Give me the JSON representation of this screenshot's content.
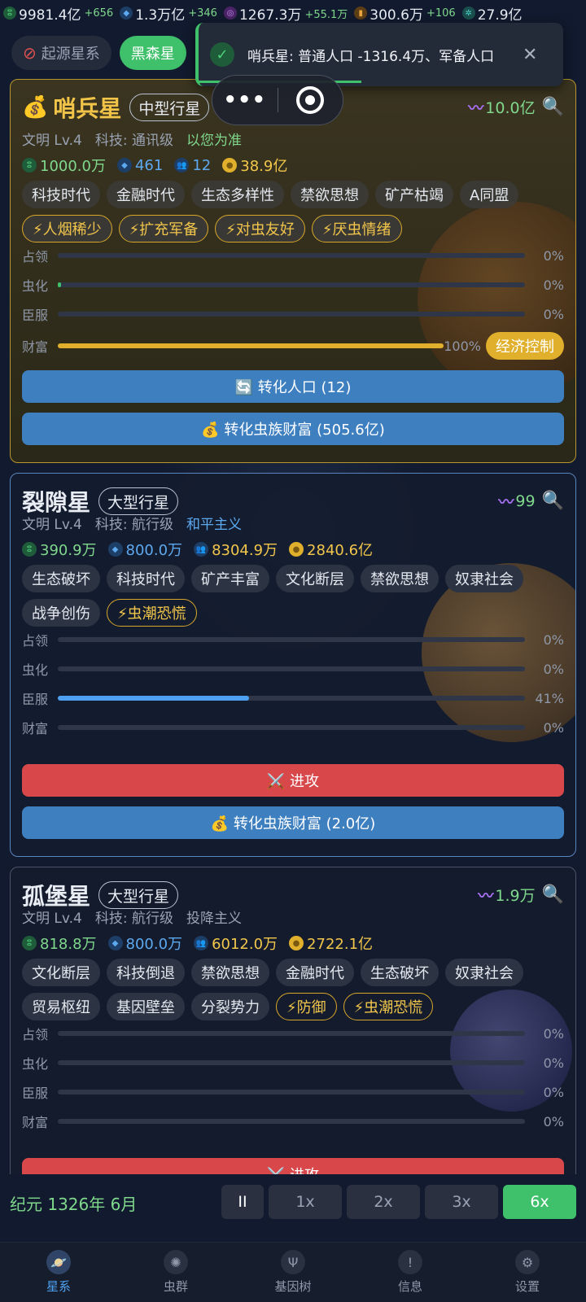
{
  "topbar": {
    "resources": [
      {
        "icon": "dna-icon",
        "value": "9981.4亿",
        "delta": "+656",
        "color": "#3fc06a"
      },
      {
        "icon": "gem-icon",
        "value": "1.3万亿",
        "delta": "+346",
        "color": "#3a90e0"
      },
      {
        "icon": "biomass-icon",
        "value": "1267.3万",
        "delta": "+55.1万",
        "color": "#a94fd8"
      },
      {
        "icon": "energy-icon",
        "value": "300.6万",
        "delta": "+106",
        "color": "#d9952b"
      },
      {
        "icon": "gear-icon",
        "value": "27.9亿",
        "delta": "",
        "color": "#38b6b0"
      }
    ]
  },
  "galaxy_tabs": [
    {
      "label": "起源星系",
      "active": false
    },
    {
      "label": "黑森星",
      "active": true
    }
  ],
  "toast": {
    "message": "哨兵星: 普通人口 -1316.4万、军备人口"
  },
  "capsule": {
    "more": "•••",
    "record": "◉"
  },
  "cards": [
    {
      "name": "哨兵星",
      "prefix": "💰",
      "type": "中型行星",
      "right_value": "10.0亿",
      "civ": "文明 Lv.4",
      "tech": "科技: 通讯级",
      "ideology": "以您为准",
      "stats": [
        {
          "icon": "dna-icon",
          "value": "1000.0万",
          "color": "#7fd88c"
        },
        {
          "icon": "gem-icon",
          "value": "461",
          "color": "#5da9f0"
        },
        {
          "icon": "people-icon",
          "value": "12",
          "color": "#5da9f0"
        },
        {
          "icon": "coin-icon",
          "value": "38.9亿",
          "color": "#f2c64b"
        }
      ],
      "tags": [
        "科技时代",
        "金融时代",
        "生态多样性",
        "禁欲思想",
        "矿产枯竭",
        "A同盟"
      ],
      "events": [
        "⚡人烟稀少",
        "⚡扩充军备",
        "⚡对虫友好",
        "⚡厌虫情绪"
      ],
      "bars": [
        {
          "label": "占领",
          "value": 0,
          "pct": "0%"
        },
        {
          "label": "虫化",
          "value": 0.003,
          "pct": "0%"
        },
        {
          "label": "臣服",
          "value": 0,
          "pct": "0%"
        },
        {
          "label": "财富",
          "value": 1,
          "pct": "100%"
        }
      ],
      "econ_label": "经济控制",
      "btn1": "🔄 转化人口 (12)",
      "btn2": "💰 转化虫族财富 (505.6亿)"
    },
    {
      "name": "裂隙星",
      "type": "大型行星",
      "right_value": "99",
      "civ": "文明 Lv.4",
      "tech": "科技: 航行级",
      "ideology": "和平主义",
      "stats": [
        {
          "icon": "dna-icon",
          "value": "390.9万",
          "color": "#7fd88c"
        },
        {
          "icon": "gem-icon",
          "value": "800.0万",
          "color": "#5da9f0"
        },
        {
          "icon": "people-icon",
          "value": "8304.9万",
          "color": "#f2c64b"
        },
        {
          "icon": "coin-icon",
          "value": "2840.6亿",
          "color": "#f2c64b"
        }
      ],
      "tags": [
        "生态破坏",
        "科技时代",
        "矿产丰富",
        "文化断层",
        "禁欲思想",
        "奴隶社会",
        "战争创伤"
      ],
      "events": [
        "⚡虫潮恐慌"
      ],
      "bars": [
        {
          "label": "占领",
          "value": 0,
          "pct": "0%"
        },
        {
          "label": "虫化",
          "value": 0,
          "pct": "0%"
        },
        {
          "label": "臣服",
          "value": 0.41,
          "pct": "41%"
        },
        {
          "label": "财富",
          "value": 0,
          "pct": "0%"
        }
      ],
      "btn1": "⚔️ 进攻",
      "btn2": "💰 转化虫族财富 (2.0亿)"
    },
    {
      "name": "孤堡星",
      "type": "大型行星",
      "right_value": "1.9万",
      "civ": "文明 Lv.4",
      "tech": "科技: 航行级",
      "ideology": "投降主义",
      "stats": [
        {
          "icon": "dna-icon",
          "value": "818.8万",
          "color": "#7fd88c"
        },
        {
          "icon": "gem-icon",
          "value": "800.0万",
          "color": "#5da9f0"
        },
        {
          "icon": "people-icon",
          "value": "6012.0万",
          "color": "#f2c64b"
        },
        {
          "icon": "coin-icon",
          "value": "2722.1亿",
          "color": "#f2c64b"
        }
      ],
      "tags": [
        "文化断层",
        "科技倒退",
        "禁欲思想",
        "金融时代",
        "生态破坏",
        "奴隶社会",
        "贸易枢纽",
        "基因壁垒",
        "分裂势力"
      ],
      "events": [
        "⚡防御",
        "⚡虫潮恐慌"
      ],
      "bars": [
        {
          "label": "占领",
          "value": 0,
          "pct": "0%"
        },
        {
          "label": "虫化",
          "value": 0,
          "pct": "0%"
        },
        {
          "label": "臣服",
          "value": 0,
          "pct": "0%"
        },
        {
          "label": "财富",
          "value": 0,
          "pct": "0%"
        }
      ],
      "btn1": "⚔️ 进攻"
    }
  ],
  "controls": {
    "era": "纪元 1326年 6月",
    "pause": "II",
    "speeds": [
      "1x",
      "2x",
      "3x",
      "6x"
    ],
    "active_speed": "6x"
  },
  "nav": [
    {
      "label": "星系",
      "icon": "galaxy-icon",
      "active": true
    },
    {
      "label": "虫群",
      "icon": "swarm-icon",
      "active": false
    },
    {
      "label": "基因树",
      "icon": "gene-tree-icon",
      "active": false
    },
    {
      "label": "信息",
      "icon": "info-icon",
      "active": false
    },
    {
      "label": "设置",
      "icon": "settings-icon",
      "active": false
    }
  ]
}
